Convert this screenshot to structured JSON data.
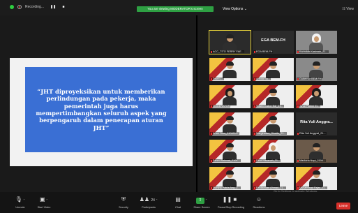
{
  "topbar": {
    "recording_label": "Recording...",
    "banner_text": "You are viewing MODERATOR's screen",
    "view_options": "View Options ⌄",
    "view_mode": "☷ View"
  },
  "shared_screen": {
    "quote": "“JHT diproyeksikan untuk memberikan perlindungan pada pekerja, maka pemerintah juga harus mempertimbangkan seluruh aspek yang berpengaruh dalam penerapan aturan JHT”"
  },
  "gallery": {
    "tiles": [
      {
        "name": "ACC_TITO FERRY FAE..."
      },
      {
        "name": "EGA BEM-FH",
        "big": "EGA BEM-FH"
      },
      {
        "name": "Karindah Kasimah_21..."
      },
      {
        "name": "Dewi L..."
      },
      {
        "name": "Arinda Na..."
      },
      {
        "name": "Gubernur BEM FH"
      },
      {
        "name": "MODERATOR"
      },
      {
        "name": "Sultan Dallon Edi_21..."
      },
      {
        "name": "Ainul Pratiwi 21..."
      },
      {
        "name": "Anan Yosa_21060117"
      },
      {
        "name": "Marginalisa_Siradis_21..."
      },
      {
        "name": "Rita Yuli Anggrat_21..."
      },
      {
        "name": "Fahmi Rahmat_2104..."
      },
      {
        "name": "Dewi Hasanah_21..."
      },
      {
        "name": "Maulana Nopi_2104..."
      },
      {
        "name": "Marsha Patria Ang_2..."
      },
      {
        "name": "Ferdiandan Ahmad_21..."
      },
      {
        "name": "Muhammad Fajar_21..."
      }
    ],
    "rita_big": "Rita Yuli Anggra..."
  },
  "toolbar": {
    "unmute": "Unmute",
    "start_video": "Start Video",
    "security": "Security",
    "participants": "Participants",
    "participants_count": "24",
    "chat": "Chat",
    "share_screen": "Share Screen",
    "pause_recording": "Pause/Stop Recording",
    "reactions": "Reactions",
    "leave": "Leave"
  },
  "watermark": "Go to Settings to activate Windows."
}
